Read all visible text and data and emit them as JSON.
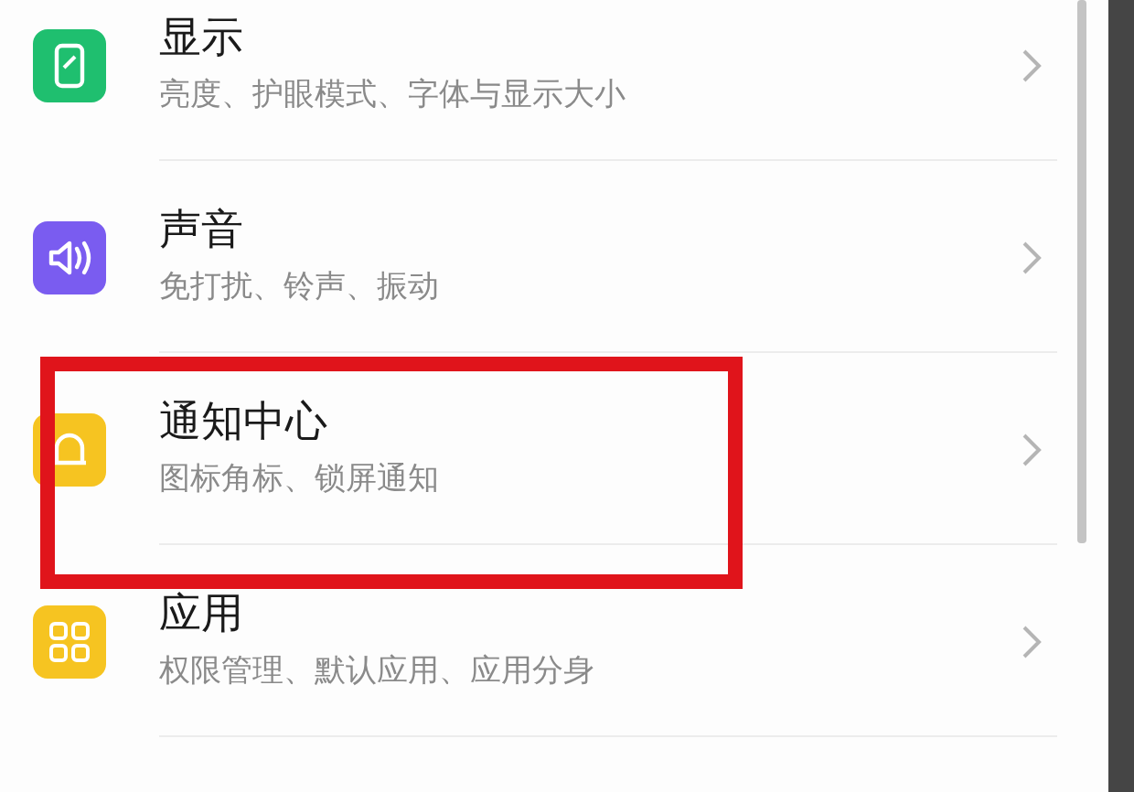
{
  "settings": [
    {
      "kind": "display",
      "color": "#1fbf6f",
      "title": "显示",
      "subtitle": "亮度、护眼模式、字体与显示大小",
      "highlighted": false
    },
    {
      "kind": "sound",
      "color": "#7a5cf0",
      "title": "声音",
      "subtitle": "免打扰、铃声、振动",
      "highlighted": false
    },
    {
      "kind": "bell",
      "color": "#f6c421",
      "title": "通知中心",
      "subtitle": "图标角标、锁屏通知",
      "highlighted": true
    },
    {
      "kind": "grid",
      "color": "#f6c421",
      "title": "应用",
      "subtitle": "权限管理、默认应用、应用分身",
      "highlighted": false
    }
  ]
}
